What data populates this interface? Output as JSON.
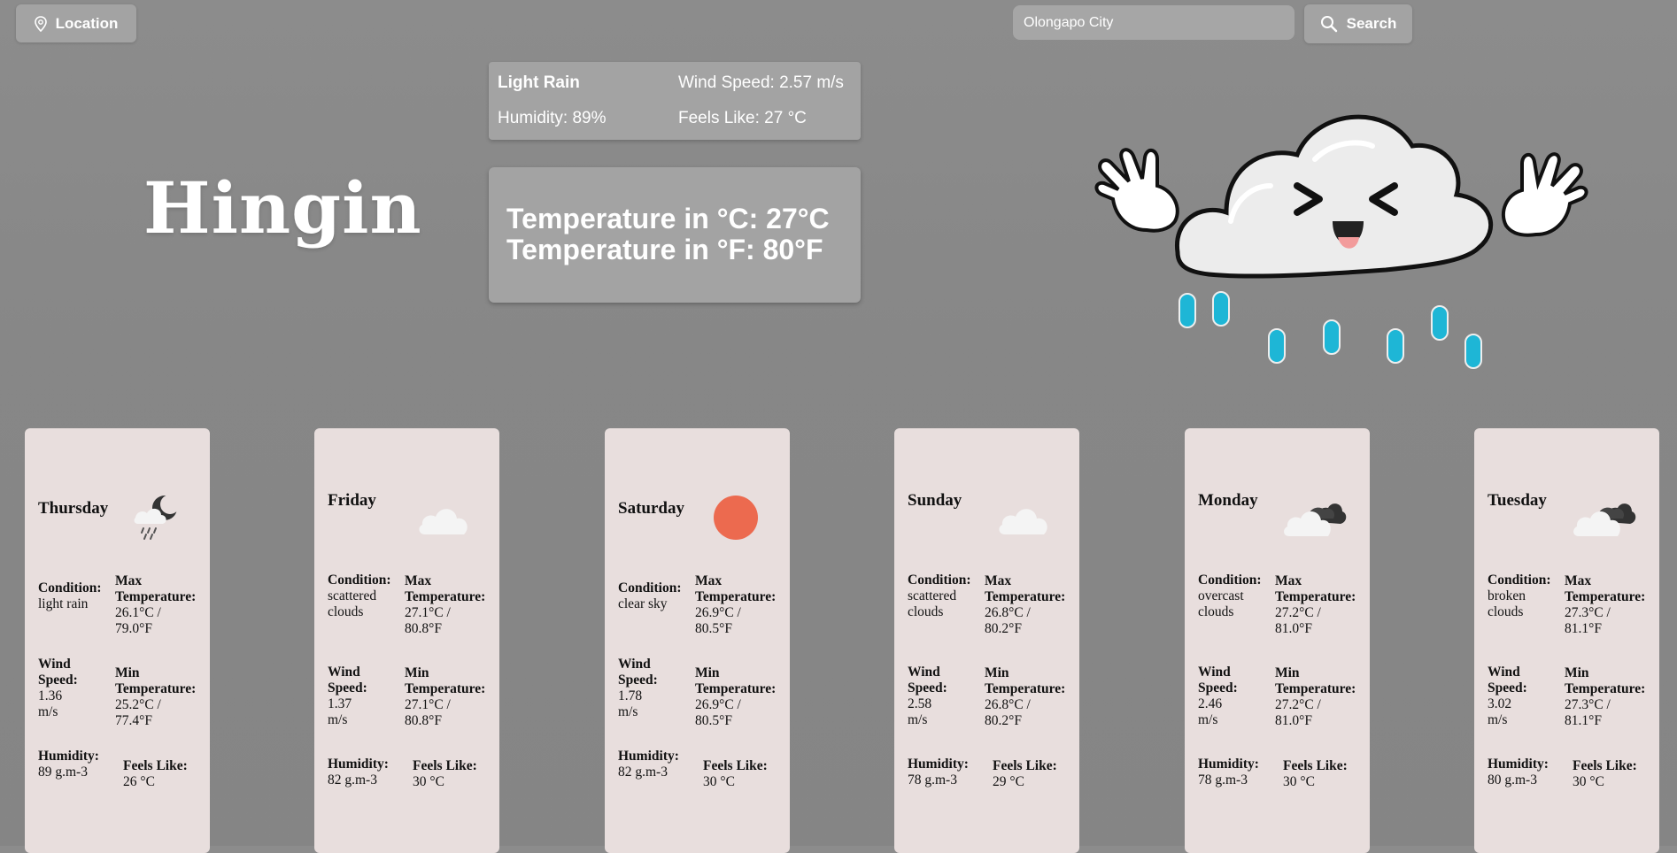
{
  "header": {
    "location_label": "Location",
    "search_value": "Olongapo City",
    "search_label": "Search"
  },
  "current": {
    "city": "Hingin",
    "condition": "Light Rain",
    "wind_speed": "Wind Speed: 2.57 m/s",
    "humidity": "Humidity: 89%",
    "feels_like": "Feels Like: 27 °C",
    "temp_c": "Temperature in °C: 27°C",
    "temp_f": "Temperature in °F: 80°F"
  },
  "forecast": [
    {
      "day": "Thursday",
      "icon": "rain-night-icon",
      "condition": [
        "Condition:",
        "light rain"
      ],
      "max": [
        "Max",
        "Temperature:",
        "26.1°C /",
        "79.0°F"
      ],
      "wind": [
        "Wind",
        "Speed:",
        "1.36",
        "m/s"
      ],
      "min": [
        "Min",
        "Temperature:",
        "25.2°C /",
        "77.4°F"
      ],
      "humidity": [
        "Humidity:",
        "89 g.m-3"
      ],
      "feels": [
        "Feels Like:",
        "26 °C"
      ]
    },
    {
      "day": "Friday",
      "icon": "cloud-icon",
      "condition": [
        "Condition:",
        "scattered",
        "clouds"
      ],
      "max": [
        "Max",
        "Temperature:",
        "27.1°C /",
        "80.8°F"
      ],
      "wind": [
        "Wind",
        "Speed:",
        "1.37",
        "m/s"
      ],
      "min": [
        "Min",
        "Temperature:",
        "27.1°C /",
        "80.8°F"
      ],
      "humidity": [
        "Humidity:",
        "82 g.m-3"
      ],
      "feels": [
        "Feels Like:",
        "30 °C"
      ]
    },
    {
      "day": "Saturday",
      "icon": "sun-icon",
      "condition": [
        "Condition:",
        "clear sky"
      ],
      "max": [
        "Max",
        "Temperature:",
        "26.9°C /",
        "80.5°F"
      ],
      "wind": [
        "Wind",
        "Speed:",
        "1.78",
        "m/s"
      ],
      "min": [
        "Min",
        "Temperature:",
        "26.9°C /",
        "80.5°F"
      ],
      "humidity": [
        "Humidity:",
        "82 g.m-3"
      ],
      "feels": [
        "Feels Like:",
        "30 °C"
      ]
    },
    {
      "day": "Sunday",
      "icon": "cloud-icon",
      "condition": [
        "Condition:",
        "scattered",
        "clouds"
      ],
      "max": [
        "Max",
        "Temperature:",
        "26.8°C /",
        "80.2°F"
      ],
      "wind": [
        "Wind",
        "Speed:",
        "2.58",
        "m/s"
      ],
      "min": [
        "Min",
        "Temperature:",
        "26.8°C /",
        "80.2°F"
      ],
      "humidity": [
        "Humidity:",
        "78 g.m-3"
      ],
      "feels": [
        "Feels Like:",
        "29 °C"
      ]
    },
    {
      "day": "Monday",
      "icon": "overcast-clouds-icon",
      "condition": [
        "Condition:",
        "overcast",
        "clouds"
      ],
      "max": [
        "Max",
        "Temperature:",
        "27.2°C /",
        "81.0°F"
      ],
      "wind": [
        "Wind",
        "Speed:",
        "2.46",
        "m/s"
      ],
      "min": [
        "Min",
        "Temperature:",
        "27.2°C /",
        "81.0°F"
      ],
      "humidity": [
        "Humidity:",
        "78 g.m-3"
      ],
      "feels": [
        "Feels Like:",
        "30 °C"
      ]
    },
    {
      "day": "Tuesday",
      "icon": "broken-clouds-icon",
      "condition": [
        "Condition:",
        "broken",
        "clouds"
      ],
      "max": [
        "Max",
        "Temperature:",
        "27.3°C /",
        "81.1°F"
      ],
      "wind": [
        "Wind",
        "Speed:",
        "3.02",
        "m/s"
      ],
      "min": [
        "Min",
        "Temperature:",
        "27.3°C /",
        "81.1°F"
      ],
      "humidity": [
        "Humidity:",
        "80 g.m-3"
      ],
      "feels": [
        "Feels Like:",
        "30 °C"
      ]
    }
  ],
  "colors": {
    "sun": "#ec6a4f",
    "rain_drop": "#1eb6d6",
    "card_bg": "#e8dedd"
  },
  "mascot_icon": "rain-cloud-mascot-icon"
}
